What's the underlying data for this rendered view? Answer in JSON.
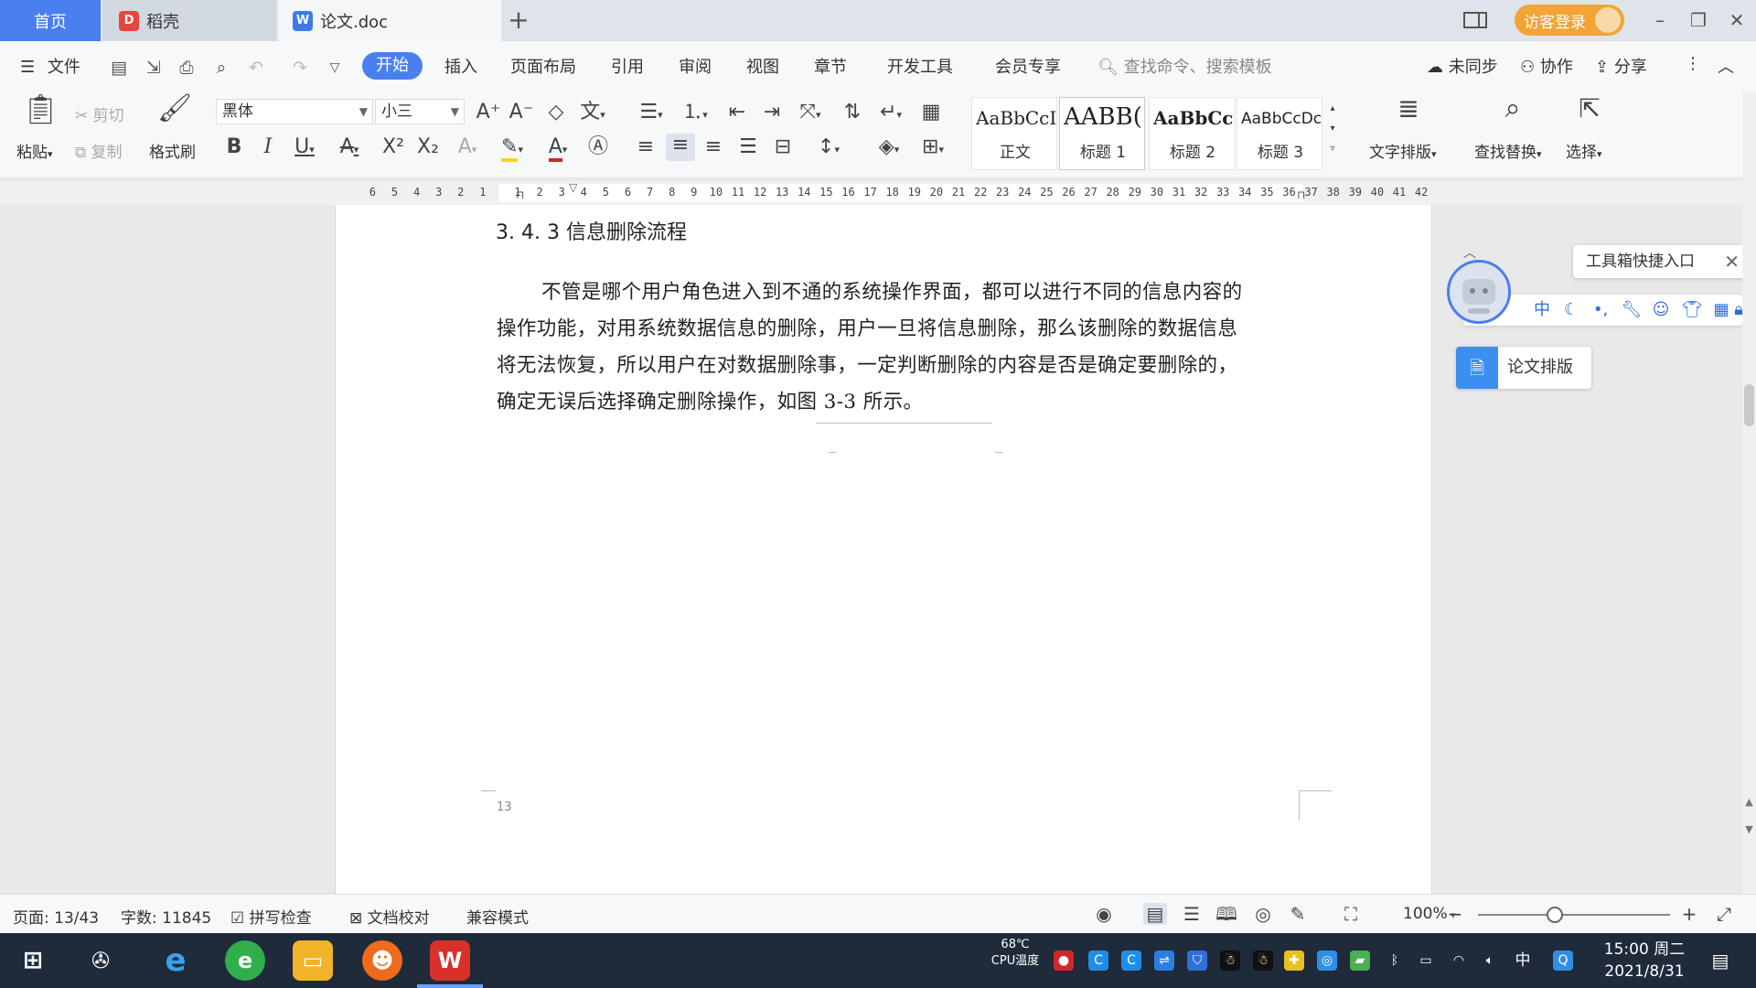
{
  "tabs": {
    "home": "首页",
    "daoke": "稻壳",
    "doc": "论文.doc"
  },
  "titlebar": {
    "login": "访客登录"
  },
  "menu": {
    "file": "文件",
    "start": "开始",
    "insert": "插入",
    "layout": "页面布局",
    "reference": "引用",
    "review": "审阅",
    "view": "视图",
    "chapter": "章节",
    "devtools": "开发工具",
    "member": "会员专享",
    "search_placeholder": "查找命令、搜索模板",
    "unsynced": "未同步",
    "collaborate": "协作",
    "share": "分享"
  },
  "ribbon": {
    "paste": "粘贴",
    "cut": "剪切",
    "copy": "复制",
    "format_painter": "格式刷",
    "font_name": "黑体",
    "font_size": "小三",
    "styles": [
      {
        "preview": "AaBbCcI",
        "name": "正文"
      },
      {
        "preview": "AABB(",
        "name": "标题 1"
      },
      {
        "preview": "AaBbCc",
        "name": "标题 2"
      },
      {
        "preview": "AaBbCcDc",
        "name": "标题 3"
      }
    ],
    "text_layout": "文字排版",
    "find_replace": "查找替换",
    "select": "选择"
  },
  "ruler": {
    "left_numbers": [
      "6",
      "5",
      "4",
      "3",
      "2",
      "1"
    ],
    "right_numbers": [
      "1",
      "2",
      "3",
      "4",
      "5",
      "6",
      "7",
      "8",
      "9",
      "10",
      "11",
      "12",
      "13",
      "14",
      "15",
      "16",
      "17",
      "18",
      "19",
      "20",
      "21",
      "22",
      "23",
      "24",
      "25",
      "26",
      "27",
      "28",
      "29",
      "30",
      "31",
      "32",
      "33",
      "34",
      "35",
      "36",
      "37",
      "38",
      "39",
      "40",
      "41",
      "42"
    ]
  },
  "document": {
    "heading": "3. 4. 3 信息删除流程",
    "paragraph_lines": [
      "不管是哪个用户角色进入到不通的系统操作界面，都可以进行不同的信息内容的",
      "操作功能，对用系统数据信息的删除，用户一旦将信息删除，那么该删除的数据信息",
      "将无法恢复，所以用户在对数据删除事，一定判断删除的内容是否是确定要删除的，",
      "确定无误后选择确定删除操作，如图 3-3 所示。"
    ],
    "page_number": "13"
  },
  "side_panel": {
    "toolbox": "工具箱快捷入口",
    "strip_first": "中",
    "paper_format": "论文排版"
  },
  "statusbar": {
    "page": "页面: 13/43",
    "words": "字数: 11845",
    "spellcheck": "拼写检查",
    "doc_proof": "文档校对",
    "compat": "兼容模式",
    "zoom": "100%",
    "zoom_level": 0.4
  },
  "taskbar": {
    "cpu_temp": "68℃",
    "cpu_label": "CPU温度",
    "ime": "中",
    "time": "15:00 周二",
    "date": "2021/8/31"
  },
  "colors": {
    "accent": "#4a7ff0",
    "login": "#f3a436",
    "taskbar": "#1f2a3a"
  }
}
